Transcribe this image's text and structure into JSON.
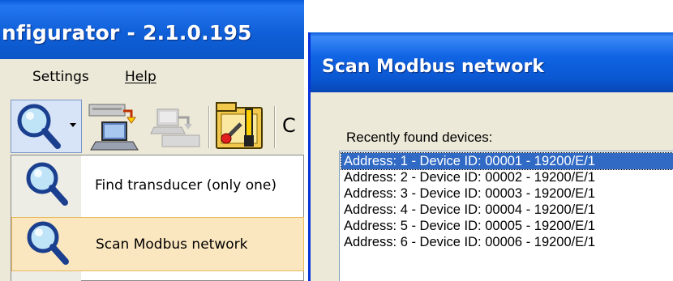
{
  "main_window": {
    "title": "nfigurator - 2.1.0.195",
    "menu": {
      "settings": "Settings",
      "help": "Help"
    },
    "toolbar": {
      "partial_label": "C"
    },
    "dropdown": {
      "items": [
        {
          "label": "Find transducer (only one)",
          "icon": "magnifier-icon"
        },
        {
          "label": "Scan Modbus network",
          "icon": "magnifier-icon",
          "highlighted": true
        }
      ]
    }
  },
  "dialog": {
    "title": "Scan Modbus network",
    "list_label": "Recently found devices:",
    "devices": [
      "Address: 1 - Device ID: 00001 - 19200/E/1",
      "Address: 2 - Device ID: 00002 - 19200/E/1",
      "Address: 3 - Device ID: 00003 - 19200/E/1",
      "Address: 4 - Device ID: 00004 - 19200/E/1",
      "Address: 5 - Device ID: 00005 - 19200/E/1",
      "Address: 6 - Device ID: 00006 - 19200/E/1"
    ],
    "selected_index": 0
  }
}
